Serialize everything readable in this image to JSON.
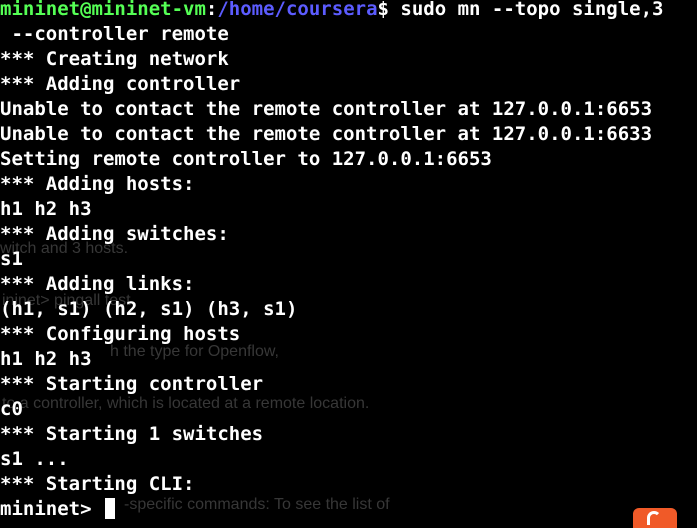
{
  "terminal": {
    "first_line": {
      "user_host": "mininet@mininet-vm",
      "colon": ":",
      "path": "/home/coursera",
      "command": "$ sudo mn --topo single,3"
    },
    "lines": [
      " --controller remote",
      "*** Creating network",
      "*** Adding controller",
      "Unable to contact the remote controller at 127.0.0.1:6653",
      "Unable to contact the remote controller at 127.0.0.1:6633",
      "Setting remote controller to 127.0.0.1:6653",
      "*** Adding hosts:",
      "h1 h2 h3",
      "*** Adding switches:",
      "s1",
      "*** Adding links:",
      "(h1, s1) (h2, s1) (h3, s1)",
      "*** Configuring hosts",
      "h1 h2 h3",
      "*** Starting controller",
      "c0",
      "*** Starting 1 switches",
      "s1 ...",
      "*** Starting CLI:"
    ],
    "current_prompt": "mininet> "
  },
  "background_text": [
    "witch and 3 hosts.",
    "ininet>  pingall test",
    "h the type for Openflow,",
    "to a controller, which is located at a remote location.",
    "-specific commands: To see the list of"
  ],
  "colors": {
    "background": "#000000",
    "text": "#ffffff",
    "prompt_user": "#55ff55",
    "prompt_path": "#5c5cff",
    "badge": "#f05a28"
  },
  "icons": {
    "badge": "orange-app-badge-icon"
  }
}
